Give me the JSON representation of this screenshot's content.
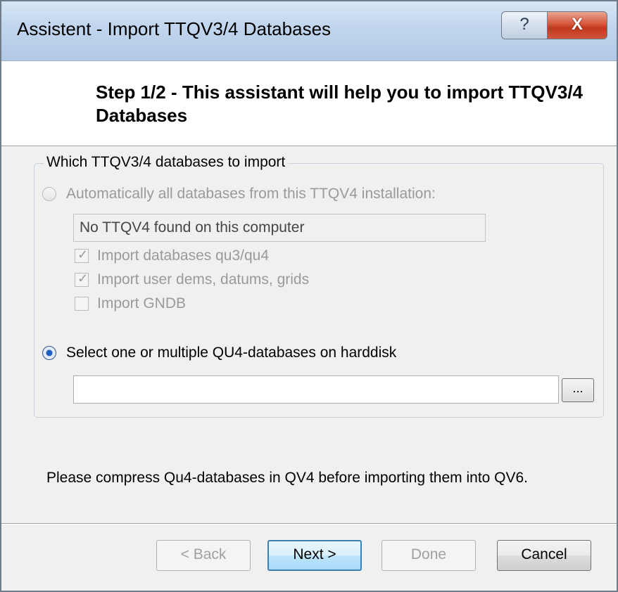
{
  "window": {
    "title": "Assistent - Import TTQV3/4 Databases",
    "help_glyph": "?",
    "close_glyph": "X"
  },
  "header": {
    "step_title": "Step 1/2 - This assistant will help you to import TTQV3/4 Databases"
  },
  "group": {
    "legend": "Which TTQV3/4 databases to import",
    "option_auto": {
      "label": "Automatically all databases from this TTQV4 installation:",
      "checked": false,
      "enabled": false
    },
    "installation_field": {
      "value": "No TTQV4 found on this computer"
    },
    "checkboxes": [
      {
        "label": "Import databases qu3/qu4",
        "checked": true
      },
      {
        "label": "Import user dems, datums, grids",
        "checked": true
      },
      {
        "label": "Import GNDB",
        "checked": false
      }
    ],
    "option_select": {
      "label": "Select one or multiple QU4-databases on harddisk",
      "checked": true,
      "enabled": true
    },
    "path_field": {
      "value": ""
    },
    "browse_label": "..."
  },
  "note": "Please compress Qu4-databases in QV4 before importing them into QV6.",
  "buttons": {
    "back": "< Back",
    "next": "Next >",
    "done": "Done",
    "cancel": "Cancel"
  }
}
